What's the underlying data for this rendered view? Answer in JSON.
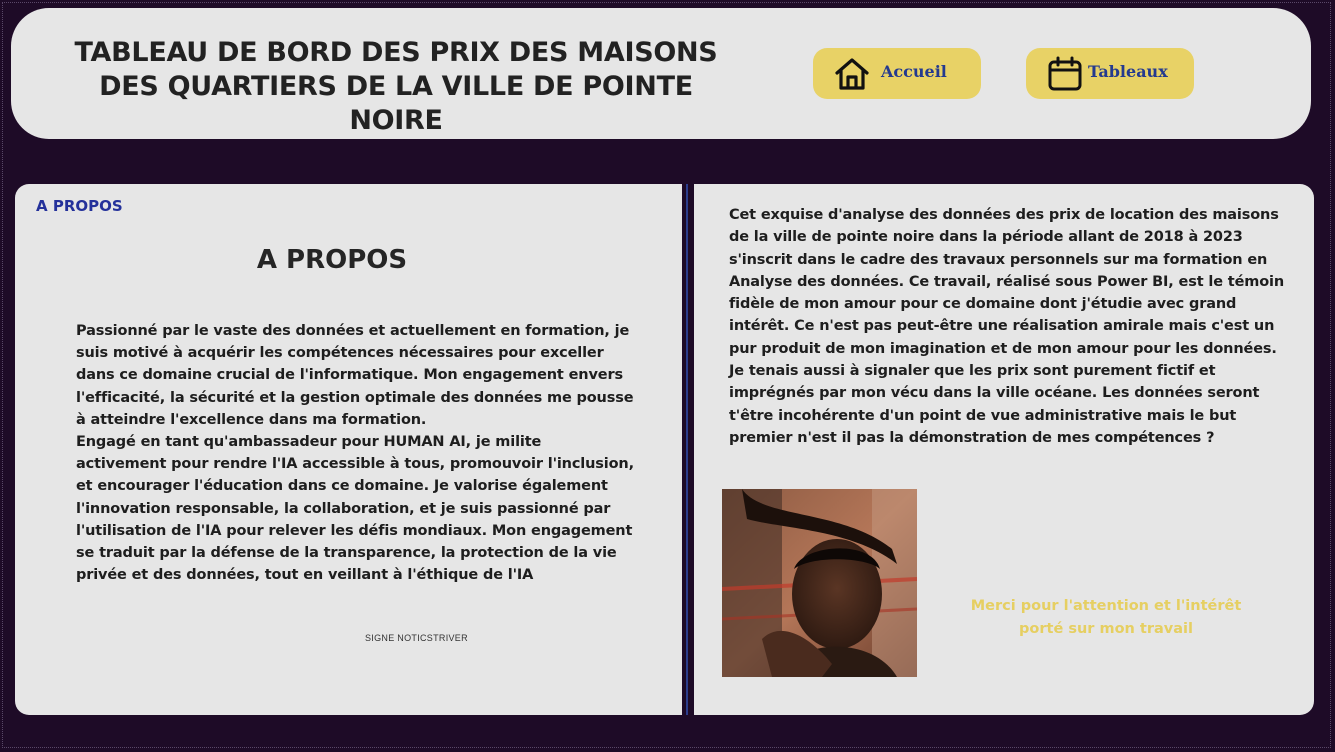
{
  "header": {
    "title": "TABLEAU DE BORD DES PRIX DES MAISONS DES QUARTIERS DE LA VILLE DE POINTE NOIRE",
    "nav": [
      {
        "label": "Accueil",
        "icon": "home-icon"
      },
      {
        "label": "Tableaux",
        "icon": "calendar-icon"
      }
    ]
  },
  "about": {
    "tag": "A PROPOS",
    "heading": "A PROPOS",
    "paragraphs": [
      "Passionné par le vaste des données et actuellement en formation, je suis motivé à acquérir les compétences nécessaires pour exceller dans ce domaine crucial de l'informatique. Mon  engagement envers l'efficacité, la sécurité et la gestion optimale des données me pousse à atteindre l'excellence dans ma formation.",
      "Engagé en tant qu'ambassadeur pour HUMAN AI, je milite activement pour rendre l'IA accessible à tous, promouvoir l'inclusion, et encourager l'éducation dans ce domaine. Je valorise également l'innovation responsable, la collaboration, et je suis passionné par l'utilisation de l'IA pour relever les défis mondiaux. Mon engagement se traduit par la défense de la transparence, la protection de la vie privée et des données, tout en veillant à l'éthique de l'IA"
    ],
    "signature": "SIGNE NOTICSTRIVER"
  },
  "project": {
    "description": "Cet exquise d'analyse des données des prix de location des maisons de la ville de pointe noire dans la période allant de 2018 à 2023 s'inscrit dans le cadre des travaux personnels sur ma formation en Analyse des données. Ce travail, réalisé sous Power BI, est le témoin fidèle de mon amour pour ce domaine dont j'étudie avec grand intérêt. Ce n'est pas peut-être une réalisation amirale mais c'est un pur produit de mon imagination et de mon amour pour les données. Je tenais aussi à signaler que les prix sont purement fictif et imprégnés par mon vécu dans la ville océane. Les données seront t'être incohérente d'un point de vue administrative mais le but premier n'est il pas la démonstration de mes compétences ?",
    "thanks": "Merci pour l'attention et l'intérêt porté sur mon travail"
  },
  "colors": {
    "background": "#1e0b27",
    "panel": "#e6e6e6",
    "button": "#e8d266",
    "nav_text": "#243a8f",
    "accent_text": "#e6cf62",
    "tag_text": "#24319a"
  }
}
